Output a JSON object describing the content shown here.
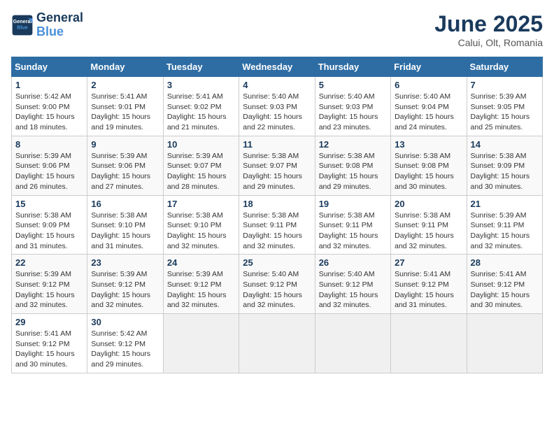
{
  "header": {
    "logo_line1": "General",
    "logo_line2": "Blue",
    "title": "June 2025",
    "subtitle": "Calui, Olt, Romania"
  },
  "calendar": {
    "days_of_week": [
      "Sunday",
      "Monday",
      "Tuesday",
      "Wednesday",
      "Thursday",
      "Friday",
      "Saturday"
    ],
    "weeks": [
      [
        {
          "day": "",
          "info": ""
        },
        {
          "day": "2",
          "info": "Sunrise: 5:41 AM\nSunset: 9:01 PM\nDaylight: 15 hours\nand 19 minutes."
        },
        {
          "day": "3",
          "info": "Sunrise: 5:41 AM\nSunset: 9:02 PM\nDaylight: 15 hours\nand 21 minutes."
        },
        {
          "day": "4",
          "info": "Sunrise: 5:40 AM\nSunset: 9:03 PM\nDaylight: 15 hours\nand 22 minutes."
        },
        {
          "day": "5",
          "info": "Sunrise: 5:40 AM\nSunset: 9:03 PM\nDaylight: 15 hours\nand 23 minutes."
        },
        {
          "day": "6",
          "info": "Sunrise: 5:40 AM\nSunset: 9:04 PM\nDaylight: 15 hours\nand 24 minutes."
        },
        {
          "day": "7",
          "info": "Sunrise: 5:39 AM\nSunset: 9:05 PM\nDaylight: 15 hours\nand 25 minutes."
        }
      ],
      [
        {
          "day": "8",
          "info": "Sunrise: 5:39 AM\nSunset: 9:06 PM\nDaylight: 15 hours\nand 26 minutes."
        },
        {
          "day": "9",
          "info": "Sunrise: 5:39 AM\nSunset: 9:06 PM\nDaylight: 15 hours\nand 27 minutes."
        },
        {
          "day": "10",
          "info": "Sunrise: 5:39 AM\nSunset: 9:07 PM\nDaylight: 15 hours\nand 28 minutes."
        },
        {
          "day": "11",
          "info": "Sunrise: 5:38 AM\nSunset: 9:07 PM\nDaylight: 15 hours\nand 29 minutes."
        },
        {
          "day": "12",
          "info": "Sunrise: 5:38 AM\nSunset: 9:08 PM\nDaylight: 15 hours\nand 29 minutes."
        },
        {
          "day": "13",
          "info": "Sunrise: 5:38 AM\nSunset: 9:08 PM\nDaylight: 15 hours\nand 30 minutes."
        },
        {
          "day": "14",
          "info": "Sunrise: 5:38 AM\nSunset: 9:09 PM\nDaylight: 15 hours\nand 30 minutes."
        }
      ],
      [
        {
          "day": "15",
          "info": "Sunrise: 5:38 AM\nSunset: 9:09 PM\nDaylight: 15 hours\nand 31 minutes."
        },
        {
          "day": "16",
          "info": "Sunrise: 5:38 AM\nSunset: 9:10 PM\nDaylight: 15 hours\nand 31 minutes."
        },
        {
          "day": "17",
          "info": "Sunrise: 5:38 AM\nSunset: 9:10 PM\nDaylight: 15 hours\nand 32 minutes."
        },
        {
          "day": "18",
          "info": "Sunrise: 5:38 AM\nSunset: 9:11 PM\nDaylight: 15 hours\nand 32 minutes."
        },
        {
          "day": "19",
          "info": "Sunrise: 5:38 AM\nSunset: 9:11 PM\nDaylight: 15 hours\nand 32 minutes."
        },
        {
          "day": "20",
          "info": "Sunrise: 5:38 AM\nSunset: 9:11 PM\nDaylight: 15 hours\nand 32 minutes."
        },
        {
          "day": "21",
          "info": "Sunrise: 5:39 AM\nSunset: 9:11 PM\nDaylight: 15 hours\nand 32 minutes."
        }
      ],
      [
        {
          "day": "22",
          "info": "Sunrise: 5:39 AM\nSunset: 9:12 PM\nDaylight: 15 hours\nand 32 minutes."
        },
        {
          "day": "23",
          "info": "Sunrise: 5:39 AM\nSunset: 9:12 PM\nDaylight: 15 hours\nand 32 minutes."
        },
        {
          "day": "24",
          "info": "Sunrise: 5:39 AM\nSunset: 9:12 PM\nDaylight: 15 hours\nand 32 minutes."
        },
        {
          "day": "25",
          "info": "Sunrise: 5:40 AM\nSunset: 9:12 PM\nDaylight: 15 hours\nand 32 minutes."
        },
        {
          "day": "26",
          "info": "Sunrise: 5:40 AM\nSunset: 9:12 PM\nDaylight: 15 hours\nand 32 minutes."
        },
        {
          "day": "27",
          "info": "Sunrise: 5:41 AM\nSunset: 9:12 PM\nDaylight: 15 hours\nand 31 minutes."
        },
        {
          "day": "28",
          "info": "Sunrise: 5:41 AM\nSunset: 9:12 PM\nDaylight: 15 hours\nand 30 minutes."
        }
      ],
      [
        {
          "day": "29",
          "info": "Sunrise: 5:41 AM\nSunset: 9:12 PM\nDaylight: 15 hours\nand 30 minutes."
        },
        {
          "day": "30",
          "info": "Sunrise: 5:42 AM\nSunset: 9:12 PM\nDaylight: 15 hours\nand 29 minutes."
        },
        {
          "day": "",
          "info": ""
        },
        {
          "day": "",
          "info": ""
        },
        {
          "day": "",
          "info": ""
        },
        {
          "day": "",
          "info": ""
        },
        {
          "day": "",
          "info": ""
        }
      ]
    ],
    "week1_sunday": {
      "day": "1",
      "info": "Sunrise: 5:42 AM\nSunset: 9:00 PM\nDaylight: 15 hours\nand 18 minutes."
    }
  }
}
